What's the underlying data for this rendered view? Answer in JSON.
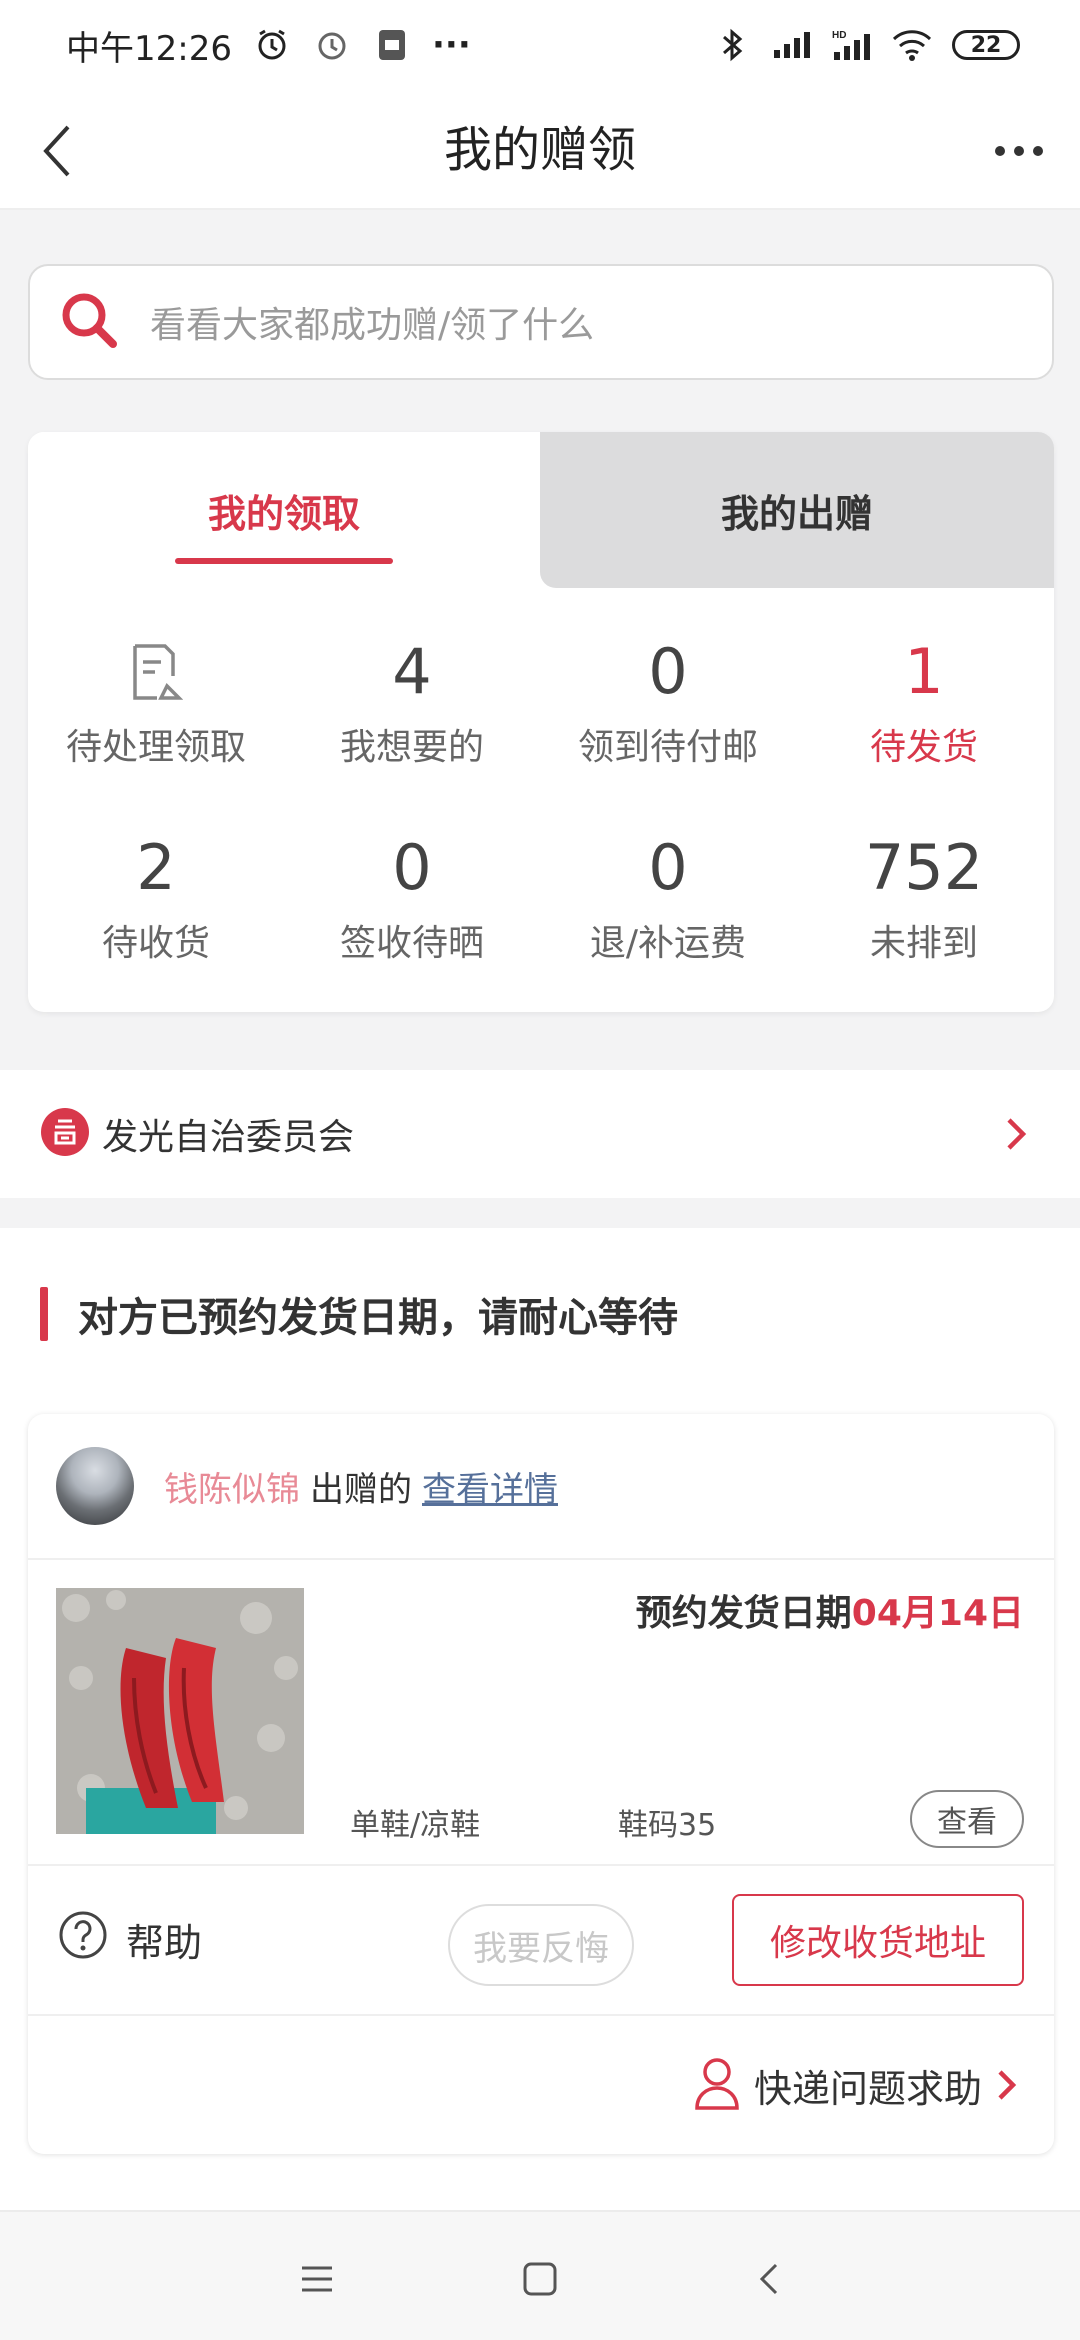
{
  "status_bar": {
    "time": "中午12:26",
    "dots": "···",
    "battery": "22"
  },
  "header": {
    "title": "我的赠领"
  },
  "search": {
    "placeholder": "看看大家都成功赠/领了什么"
  },
  "tabs": [
    {
      "label": "我的领取",
      "active": true
    },
    {
      "label": "我的出赠",
      "active": false
    }
  ],
  "stats": [
    {
      "value": "",
      "label": "待处理领取",
      "icon": "document-edit-icon"
    },
    {
      "value": "4",
      "label": "我想要的"
    },
    {
      "value": "0",
      "label": "领到待付邮"
    },
    {
      "value": "1",
      "label": "待发货",
      "highlight": true
    },
    {
      "value": "2",
      "label": "待收货"
    },
    {
      "value": "0",
      "label": "签收待晒"
    },
    {
      "value": "0",
      "label": "退/补运费"
    },
    {
      "value": "752",
      "label": "未排到"
    }
  ],
  "committee": {
    "label": "发光自治委员会",
    "icon": "committee-icon"
  },
  "section": {
    "title": "对方已预约发货日期，请耐心等待"
  },
  "order": {
    "donor": "钱陈似锦",
    "donated_text": "出赠的",
    "details_link": "查看详情",
    "ship_label": "预约发货日期",
    "ship_date": "04月14日",
    "category": "单鞋/凉鞋",
    "size": "鞋码35",
    "view_button": "查看",
    "help_label": "帮助",
    "regret_button": "我要反悔",
    "modify_button": "修改收货地址",
    "express_label": "快递问题求助"
  },
  "colors": {
    "accent": "#d8384b",
    "donor_name": "#e88a96",
    "link": "#56709a"
  }
}
